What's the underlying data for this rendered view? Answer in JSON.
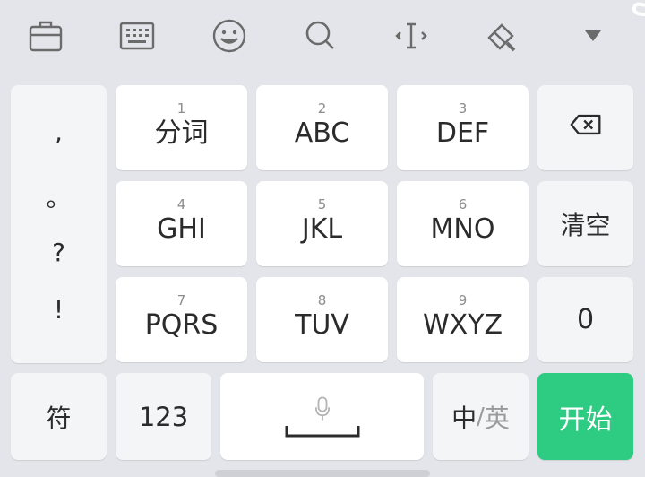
{
  "toolbar": {
    "icons": [
      "briefcase-icon",
      "keyboard-icon",
      "emoji-icon",
      "search-icon",
      "cursor-move-icon",
      "clipboard-brush-icon",
      "collapse-arrow-icon"
    ]
  },
  "punctuation": [
    ",",
    "。",
    "?",
    "!"
  ],
  "keys": {
    "k1": {
      "num": "1",
      "label": "分词"
    },
    "k2": {
      "num": "2",
      "label": "ABC"
    },
    "k3": {
      "num": "3",
      "label": "DEF"
    },
    "k4": {
      "num": "4",
      "label": "GHI"
    },
    "k5": {
      "num": "5",
      "label": "JKL"
    },
    "k6": {
      "num": "6",
      "label": "MNO"
    },
    "k7": {
      "num": "7",
      "label": "PQRS"
    },
    "k8": {
      "num": "8",
      "label": "TUV"
    },
    "k9": {
      "num": "9",
      "label": "WXYZ"
    }
  },
  "side": {
    "backspace_icon": "backspace-icon",
    "clear": "清空",
    "zero": "0"
  },
  "bottom": {
    "symbols": "符",
    "numbers": "123",
    "lang_zh": "中",
    "lang_sep": "/",
    "lang_en": "英",
    "go": "开始"
  },
  "colors": {
    "background": "#e4e5ea",
    "key": "#ffffff",
    "function_key": "#f4f5f7",
    "accent": "#2ecb83"
  }
}
